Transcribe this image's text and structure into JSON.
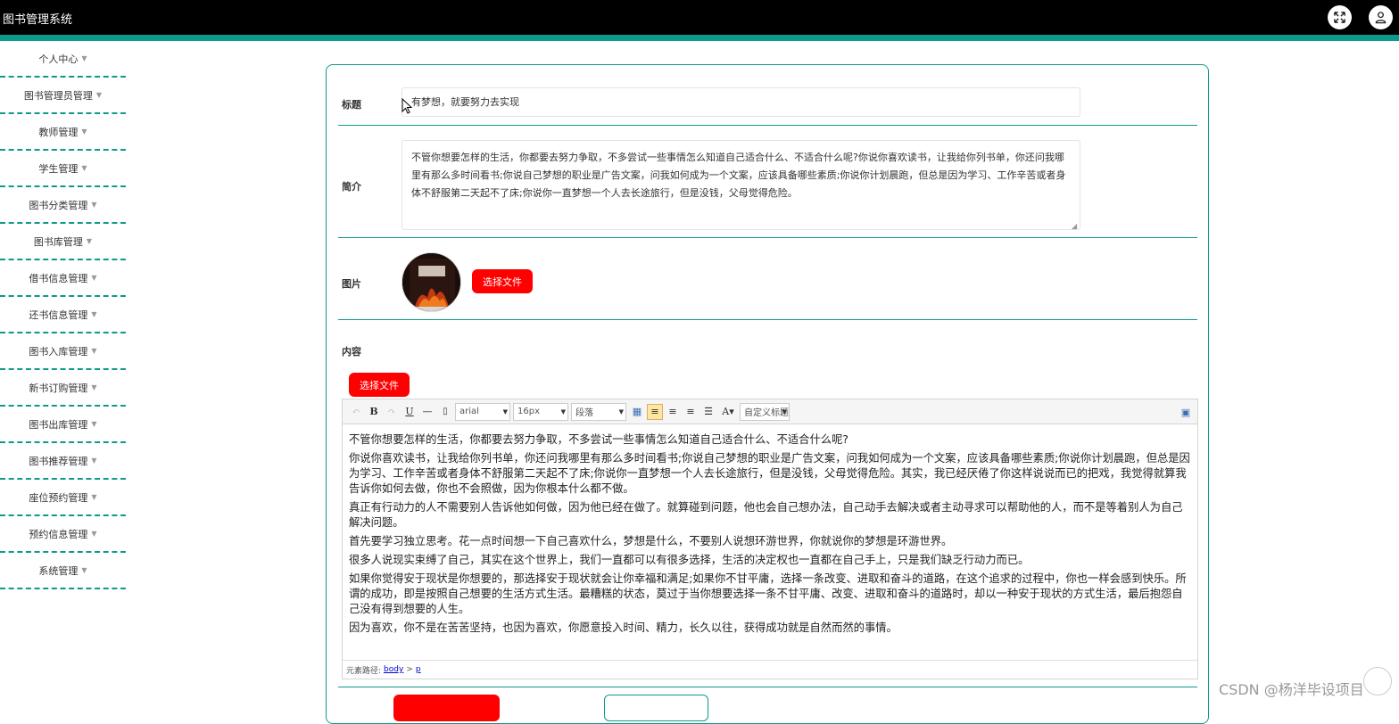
{
  "header": {
    "title": "图书管理系统",
    "fullscreen_icon": "expand-icon",
    "user_icon": "user-icon"
  },
  "colors": {
    "accent": "#0e9a8a",
    "danger": "#ff0000",
    "header_bg": "#000000"
  },
  "sidebar": {
    "items": [
      {
        "label": "个人中心"
      },
      {
        "label": "图书管理员管理"
      },
      {
        "label": "教师管理"
      },
      {
        "label": "学生管理"
      },
      {
        "label": "图书分类管理"
      },
      {
        "label": "图书库管理"
      },
      {
        "label": "借书信息管理"
      },
      {
        "label": "还书信息管理"
      },
      {
        "label": "图书入库管理"
      },
      {
        "label": "新书订购管理"
      },
      {
        "label": "图书出库管理"
      },
      {
        "label": "图书推荐管理"
      },
      {
        "label": "座位预约管理"
      },
      {
        "label": "预约信息管理"
      },
      {
        "label": "系统管理"
      }
    ]
  },
  "form": {
    "title_label": "标题",
    "title_value": "有梦想，就要努力去实现",
    "intro_label": "简介",
    "intro_value": "不管你想要怎样的生活，你都要去努力争取，不多尝试一些事情怎么知道自己适合什么、不适合什么呢?你说你喜欢读书，让我给你列书单，你还问我哪里有那么多时间看书;你说自己梦想的职业是广告文案，问我如何成为一个文案，应该具备哪些素质;你说你计划晨跑，但总是因为学习、工作辛苦或者身体不舒服第二天起不了床;你说你一直梦想一个人去长途旅行，但是没钱，父母觉得危险。",
    "image_label": "图片",
    "image_button": "选择文件",
    "content_label": "内容",
    "content_button": "选择文件"
  },
  "editor": {
    "toolbar": {
      "font_family": "arial",
      "font_size": "16px",
      "paragraph": "段落",
      "custom_title": "自定义标题"
    },
    "paragraphs": [
      "不管你想要怎样的生活，你都要去努力争取，不多尝试一些事情怎么知道自己适合什么、不适合什么呢?",
      "你说你喜欢读书，让我给你列书单，你还问我哪里有那么多时间看书;你说自己梦想的职业是广告文案，问我如何成为一个文案，应该具备哪些素质;你说你计划晨跑，但总是因为学习、工作辛苦或者身体不舒服第二天起不了床;你说你一直梦想一个人去长途旅行，但是没钱，父母觉得危险。其实，我已经厌倦了你这样说说而已的把戏，我觉得就算我告诉你如何去做，你也不会照做，因为你根本什么都不做。",
      "真正有行动力的人不需要别人告诉他如何做，因为他已经在做了。就算碰到问题，他也会自己想办法，自己动手去解决或者主动寻求可以帮助他的人，而不是等着别人为自己解决问题。",
      "首先要学习独立思考。花一点时间想一下自己喜欢什么，梦想是什么，不要别人说想环游世界，你就说你的梦想是环游世界。",
      "很多人说现实束缚了自己，其实在这个世界上，我们一直都可以有很多选择，生活的决定权也一直都在自己手上，只是我们缺乏行动力而已。",
      "如果你觉得安于现状是你想要的，那选择安于现状就会让你幸福和满足;如果你不甘平庸，选择一条改变、进取和奋斗的道路，在这个追求的过程中，你也一样会感到快乐。所谓的成功，即是按照自己想要的生活方式生活。最糟糕的状态，莫过于当你想要选择一条不甘平庸、改变、进取和奋斗的道路时，却以一种安于现状的方式生活，最后抱怨自己没有得到想要的人生。",
      "因为喜欢，你不是在苦苦坚持，也因为喜欢，你愿意投入时间、精力，长久以往，获得成功就是自然而然的事情。"
    ],
    "path_label": "元素路径:",
    "path_body": "body",
    "path_sep": ">",
    "path_p": "p"
  },
  "watermark": "CSDN @杨洋毕设项目"
}
